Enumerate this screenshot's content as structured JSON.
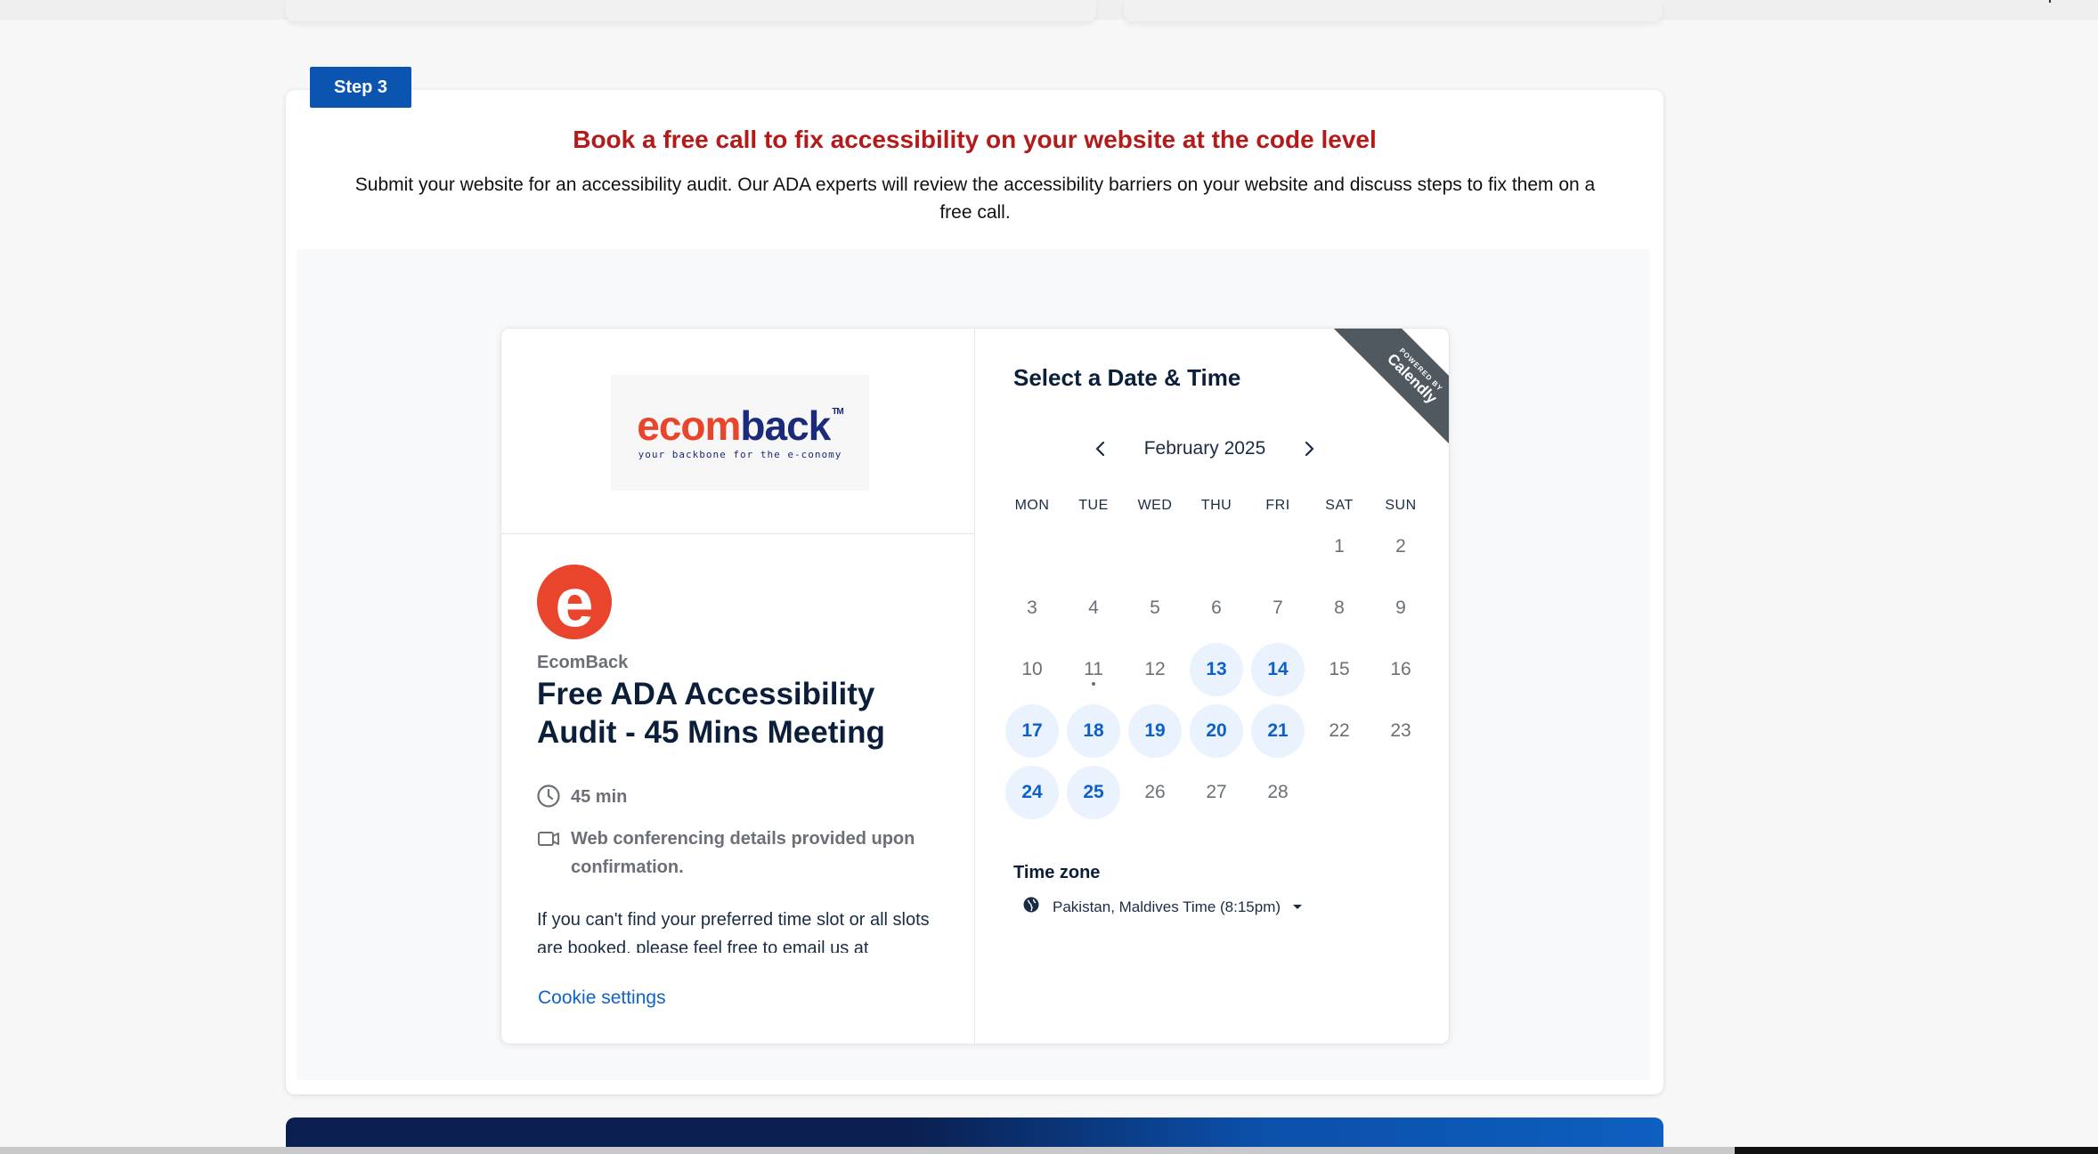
{
  "step": {
    "badge": "Step 3"
  },
  "headline": "Book a free call to fix accessibility on your website at the code level",
  "subtext": "Submit your website for an accessibility audit. Our ADA experts will review the accessibility barriers on your website and discuss steps to fix them on a free call.",
  "event": {
    "logo": {
      "part1": "ecom",
      "part2": "back",
      "tm": "TM",
      "tagline": "your backbone for the e-conomy"
    },
    "avatar_letter": "e",
    "owner": "EcomBack",
    "title": "Free ADA Accessibility Audit - 45 Mins Meeting",
    "duration": "45 min",
    "conferencing": "Web conferencing details provided upon confirmation.",
    "description": "If you can't find your preferred time slot or all slots are booked, please feel free to email us at",
    "cookie_settings": "Cookie settings"
  },
  "scheduler": {
    "title": "Select a Date & Time",
    "ribbon": {
      "powered_by": "POWERED BY",
      "brand": "Calendly"
    },
    "month": "February 2025",
    "weekdays": [
      "MON",
      "TUE",
      "WED",
      "THU",
      "FRI",
      "SAT",
      "SUN"
    ],
    "days": [
      {
        "d": "1",
        "col": 5,
        "row": 0,
        "available": false
      },
      {
        "d": "2",
        "col": 6,
        "row": 0,
        "available": false
      },
      {
        "d": "3",
        "col": 0,
        "row": 1,
        "available": false
      },
      {
        "d": "4",
        "col": 1,
        "row": 1,
        "available": false
      },
      {
        "d": "5",
        "col": 2,
        "row": 1,
        "available": false
      },
      {
        "d": "6",
        "col": 3,
        "row": 1,
        "available": false
      },
      {
        "d": "7",
        "col": 4,
        "row": 1,
        "available": false
      },
      {
        "d": "8",
        "col": 5,
        "row": 1,
        "available": false
      },
      {
        "d": "9",
        "col": 6,
        "row": 1,
        "available": false
      },
      {
        "d": "10",
        "col": 0,
        "row": 2,
        "available": false
      },
      {
        "d": "11",
        "col": 1,
        "row": 2,
        "available": false,
        "today": true
      },
      {
        "d": "12",
        "col": 2,
        "row": 2,
        "available": false
      },
      {
        "d": "13",
        "col": 3,
        "row": 2,
        "available": true
      },
      {
        "d": "14",
        "col": 4,
        "row": 2,
        "available": true
      },
      {
        "d": "15",
        "col": 5,
        "row": 2,
        "available": false
      },
      {
        "d": "16",
        "col": 6,
        "row": 2,
        "available": false
      },
      {
        "d": "17",
        "col": 0,
        "row": 3,
        "available": true
      },
      {
        "d": "18",
        "col": 1,
        "row": 3,
        "available": true
      },
      {
        "d": "19",
        "col": 2,
        "row": 3,
        "available": true
      },
      {
        "d": "20",
        "col": 3,
        "row": 3,
        "available": true
      },
      {
        "d": "21",
        "col": 4,
        "row": 3,
        "available": true
      },
      {
        "d": "22",
        "col": 5,
        "row": 3,
        "available": false
      },
      {
        "d": "23",
        "col": 6,
        "row": 3,
        "available": false
      },
      {
        "d": "24",
        "col": 0,
        "row": 4,
        "available": true
      },
      {
        "d": "25",
        "col": 1,
        "row": 4,
        "available": true
      },
      {
        "d": "26",
        "col": 2,
        "row": 4,
        "available": false
      },
      {
        "d": "27",
        "col": 3,
        "row": 4,
        "available": false
      },
      {
        "d": "28",
        "col": 4,
        "row": 4,
        "available": false
      }
    ],
    "timezone_label": "Time zone",
    "timezone_value": "Pakistan, Maldives Time (8:15pm)"
  },
  "colors": {
    "accent": "#0b55b0",
    "headline": "#b31b1b",
    "available_bg": "#eaf2fe",
    "available_text": "#0e60c9",
    "brand_red": "#e8452c",
    "brand_navy": "#1b2a7a"
  },
  "icons": [
    "clock-icon",
    "video-icon",
    "globe-icon",
    "chevron-left-icon",
    "chevron-right-icon",
    "caret-down-icon"
  ]
}
